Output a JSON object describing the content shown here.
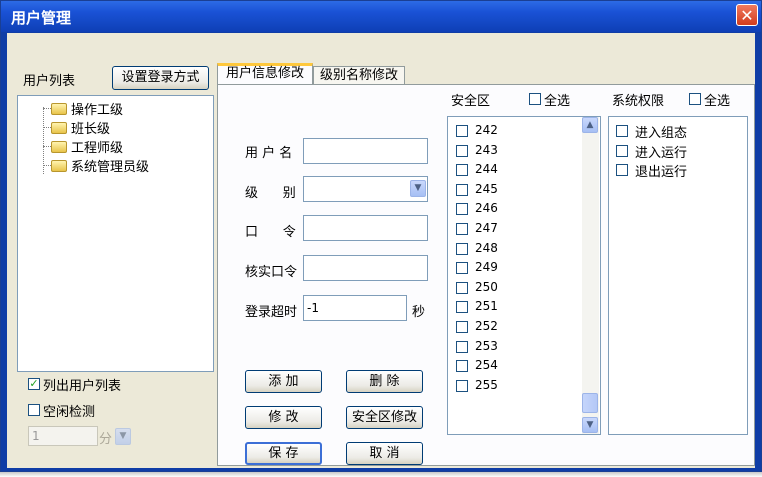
{
  "window": {
    "title": "用户管理",
    "close_icon": "✕"
  },
  "left": {
    "user_list_label": "用户列表",
    "set_login_button": "设置登录方式",
    "tree_items": [
      "操作工级",
      "班长级",
      "工程师级",
      "系统管理员级"
    ],
    "list_users_checkbox": {
      "label": "列出用户列表",
      "checked": true
    },
    "idle_detect_checkbox": {
      "label": "空闲检测",
      "checked": false
    },
    "idle_value": "1",
    "idle_unit": "分"
  },
  "tabs": [
    {
      "label": "用户信息修改",
      "active": true
    },
    {
      "label": "级别名称修改",
      "active": false
    }
  ],
  "form": {
    "username_label": "用 户 名",
    "username_value": "",
    "level_label": "级      别",
    "level_value": "",
    "password_label": "口      令",
    "password_value": "",
    "confirm_label": "核实口令",
    "confirm_value": "",
    "timeout_label": "登录超时",
    "timeout_value": "-1",
    "timeout_unit": "秒"
  },
  "buttons": {
    "add": "添 加",
    "delete": "删 除",
    "modify": "修 改",
    "security_modify": "安全区修改",
    "save": "保 存",
    "cancel": "取 消"
  },
  "security": {
    "label": "安全区",
    "select_all": "全选",
    "items": [
      "242",
      "243",
      "244",
      "245",
      "246",
      "247",
      "248",
      "249",
      "250",
      "251",
      "252",
      "253",
      "254",
      "255"
    ]
  },
  "permissions": {
    "label": "系统权限",
    "select_all": "全选",
    "items": [
      "进入组态",
      "进入运行",
      "退出运行"
    ]
  },
  "colors": {
    "title_bar": "#1a52d6",
    "window_bg": "#ece9d8",
    "close_button": "#d23c1e",
    "tab_highlight": "#ffc83c"
  }
}
